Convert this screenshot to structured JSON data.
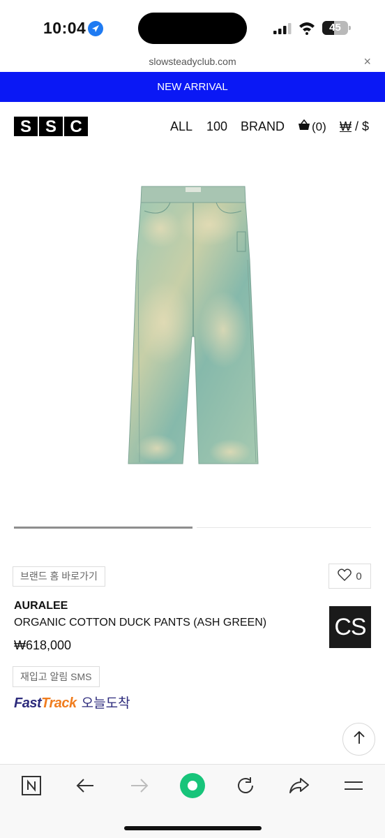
{
  "status": {
    "time": "10:04",
    "battery": "45",
    "battery_level": 0.45
  },
  "browser": {
    "url": "slowsteadyclub.com",
    "close_symbol": "×"
  },
  "banner": {
    "text": "NEW ARRIVAL",
    "color": "#0a18f5"
  },
  "header": {
    "logo_letters": [
      "S",
      "S",
      "C"
    ],
    "nav": [
      "ALL",
      "100",
      "BRAND"
    ],
    "cart_count": "(0)",
    "currency_won": "₩",
    "currency_sep": " / ",
    "currency_usd": "$"
  },
  "product": {
    "image_icon": "pants-image",
    "brand_home_label": "브랜드 홈 바로가기",
    "like_count": "0",
    "brand": "AURALEE",
    "name": "ORGANIC COTTON DUCK PANTS (ASH GREEN)",
    "price": "₩618,000",
    "badge": "CS",
    "restock_label": "재입고 알림 SMS",
    "fasttrack_fast": "Fast",
    "fasttrack_track": "Track",
    "fasttrack_today": "오늘도착",
    "image_page": 1,
    "image_pages": 2
  },
  "toolbar": {
    "icons": [
      "naver-icon",
      "back-arrow-icon",
      "forward-arrow-icon",
      "green-dot-icon",
      "refresh-icon",
      "share-icon",
      "menu-icon"
    ]
  },
  "colors": {
    "accent": "#0a18f5",
    "fasttrack_navy": "#2d2b7c",
    "fasttrack_orange": "#f07d1f",
    "green_dot": "#17c47a"
  }
}
